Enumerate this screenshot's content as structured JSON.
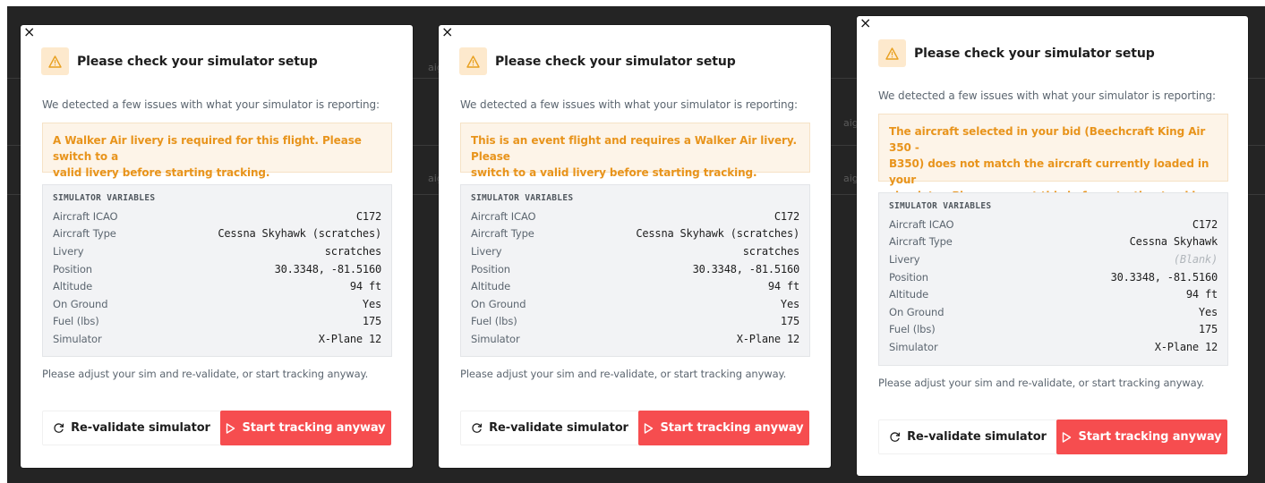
{
  "background": {
    "ghost_texts": [
      "aig",
      "aig",
      "aig",
      "aig",
      "aig",
      "aig",
      "aig"
    ]
  },
  "dialogs": [
    {
      "close_label": "×",
      "title": "Please check your simulator setup",
      "intro": "We detected a few issues with what your simulator is reporting:",
      "alert_lines": [
        "A Walker Air livery is required for this flight. Please switch to a",
        "valid livery before starting tracking."
      ],
      "vars_title": "SIMULATOR VARIABLES",
      "variables": [
        {
          "label": "Aircraft ICAO",
          "value": "C172"
        },
        {
          "label": "Aircraft Type",
          "value": "Cessna Skyhawk (scratches)"
        },
        {
          "label": "Livery",
          "value": "scratches"
        },
        {
          "label": "Position",
          "value": "30.3348, -81.5160"
        },
        {
          "label": "Altitude",
          "value": "94 ft"
        },
        {
          "label": "On Ground",
          "value": "Yes"
        },
        {
          "label": "Fuel (lbs)",
          "value": "175"
        },
        {
          "label": "Simulator",
          "value": "X-Plane 12"
        }
      ],
      "footer_note": "Please adjust your sim and re-validate, or start tracking anyway.",
      "revalidate_label": "Re-validate simulator",
      "start_label": "Start tracking anyway"
    },
    {
      "close_label": "×",
      "title": "Please check your simulator setup",
      "intro": "We detected a few issues with what your simulator is reporting:",
      "alert_lines": [
        "This is an event flight and requires a Walker Air livery. Please",
        "switch to a valid livery before starting tracking."
      ],
      "vars_title": "SIMULATOR VARIABLES",
      "variables": [
        {
          "label": "Aircraft ICAO",
          "value": "C172"
        },
        {
          "label": "Aircraft Type",
          "value": "Cessna Skyhawk (scratches)"
        },
        {
          "label": "Livery",
          "value": "scratches"
        },
        {
          "label": "Position",
          "value": "30.3348, -81.5160"
        },
        {
          "label": "Altitude",
          "value": "94 ft"
        },
        {
          "label": "On Ground",
          "value": "Yes"
        },
        {
          "label": "Fuel (lbs)",
          "value": "175"
        },
        {
          "label": "Simulator",
          "value": "X-Plane 12"
        }
      ],
      "footer_note": "Please adjust your sim and re-validate, or start tracking anyway.",
      "revalidate_label": "Re-validate simulator",
      "start_label": "Start tracking anyway"
    },
    {
      "close_label": "×",
      "title": "Please check your simulator setup",
      "intro": "We detected a few issues with what your simulator is reporting:",
      "alert_lines": [
        "The aircraft selected in your bid (Beechcraft King Air 350 -",
        "B350) does not match the aircraft currently loaded in your",
        "simulator. Please correct this before starting tracking."
      ],
      "vars_title": "SIMULATOR VARIABLES",
      "variables": [
        {
          "label": "Aircraft ICAO",
          "value": "C172"
        },
        {
          "label": "Aircraft Type",
          "value": "Cessna Skyhawk"
        },
        {
          "label": "Livery",
          "value": "(Blank)",
          "blank": true
        },
        {
          "label": "Position",
          "value": "30.3348, -81.5160"
        },
        {
          "label": "Altitude",
          "value": "94 ft"
        },
        {
          "label": "On Ground",
          "value": "Yes"
        },
        {
          "label": "Fuel (lbs)",
          "value": "175"
        },
        {
          "label": "Simulator",
          "value": "X-Plane 12"
        }
      ],
      "footer_note": "Please adjust your sim and re-validate, or start tracking anyway.",
      "revalidate_label": "Re-validate simulator",
      "start_label": "Start tracking anyway"
    }
  ],
  "colors": {
    "accent": "#f64d4f",
    "warning_text": "#e8941c",
    "warning_bg": "#fdf4e8",
    "backdrop": "#242424"
  },
  "icons": {
    "warning": "warning-triangle-icon",
    "close": "close-icon",
    "refresh": "refresh-icon",
    "play": "play-icon"
  }
}
